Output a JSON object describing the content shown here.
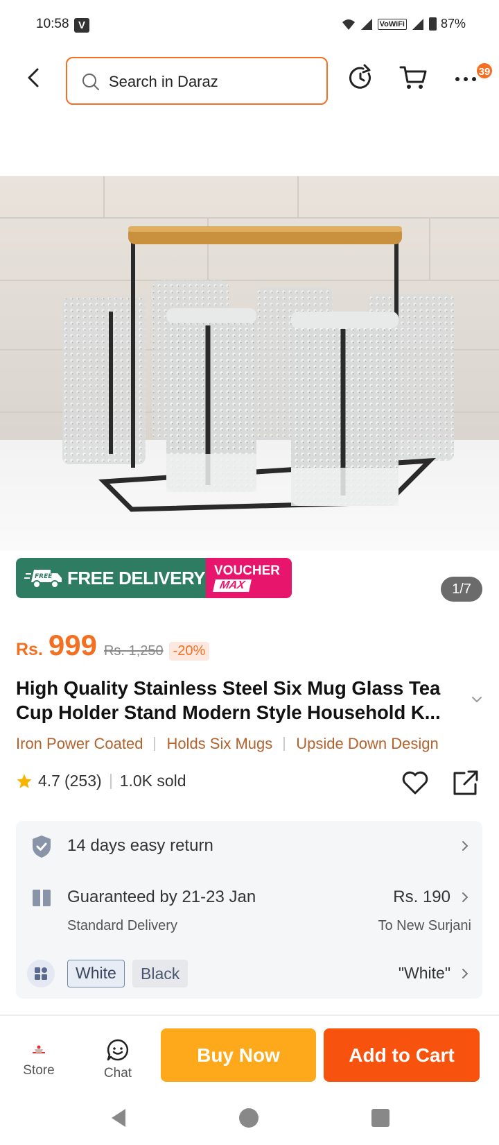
{
  "status_bar": {
    "time": "10:58",
    "v_icon": "V",
    "vowifi": "VoWiFi",
    "battery": "87%"
  },
  "header": {
    "search_placeholder": "Search in Daraz",
    "cart_badge": "39"
  },
  "gallery": {
    "counter": "1/7"
  },
  "promo": {
    "free_delivery": "FREE DELIVERY",
    "truck_text": "FREE",
    "voucher_line1": "VOUCHER",
    "voucher_line2": "MAX"
  },
  "price": {
    "currency": "Rs.",
    "current": "999",
    "original": "Rs. 1,250",
    "discount": "-20%"
  },
  "product": {
    "title": "High Quality Stainless Steel Six Mug Glass Tea Cup Holder Stand Modern Style Household K...",
    "features": [
      "Iron Power Coated",
      "Holds Six Mugs",
      "Upside Down Design"
    ],
    "rating": "4.7",
    "reviews": "(253)",
    "sold": "1.0K sold"
  },
  "service": {
    "return_text": "14 days easy return",
    "guarantee_text": "Guaranteed by 21-23 Jan",
    "delivery_type": "Standard Delivery",
    "shipping_price": "Rs. 190",
    "ship_to": "To New Surjani"
  },
  "variants": {
    "options": [
      "White",
      "Black"
    ],
    "selected": "\"White\""
  },
  "bottom_bar": {
    "store_label": "Store",
    "chat_label": "Chat",
    "buy_now": "Buy Now",
    "add_to_cart": "Add to Cart"
  },
  "colors": {
    "brand_orange": "#f36f21",
    "buy_now": "#fda91b",
    "add_to_cart": "#f8520f",
    "free_delivery_green": "#2e7d62",
    "voucher_pink": "#e8156d"
  }
}
